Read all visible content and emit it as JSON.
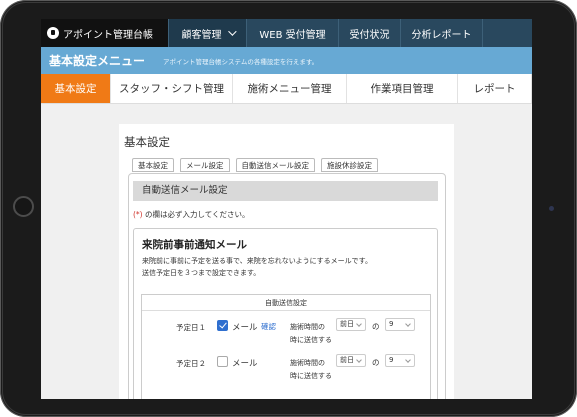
{
  "app": {
    "brand": "アポイント管理台帳"
  },
  "topnav": {
    "items": [
      {
        "label": "顧客管理"
      },
      {
        "label": "WEB 受付管理"
      },
      {
        "label": "受付状況"
      },
      {
        "label": "分析レポート"
      }
    ]
  },
  "banner": {
    "title": "基本設定メニュー",
    "subtitle": "アポイント管理台帳システムの各種設定を行えます。"
  },
  "tabs": [
    {
      "label": "基本設定",
      "active": true
    },
    {
      "label": "スタッフ・シフト管理"
    },
    {
      "label": "施術メニュー管理"
    },
    {
      "label": "作業項目管理"
    },
    {
      "label": "レポート"
    }
  ],
  "panel": {
    "title": "基本設定",
    "subtabs": [
      "基本設定",
      "メール設定",
      "自動送信メール設定",
      "施設休診設定"
    ],
    "section_title": "自動送信メール設定",
    "required_mark": "(*)",
    "required_text": " の欄は必ず入力してください。",
    "card": {
      "title": "来院前事前通知メール",
      "desc_line1": "来院前に事前に予定を送る事で、来院を忘れないようにするメールです。",
      "desc_line2": "送信予定日を３つまで設定できます。",
      "settings_header": "自動送信設定",
      "rows": [
        {
          "label": "予定日１",
          "checked": true,
          "mail_label": "メール",
          "confirm_link": "確認",
          "timing_prefix": "施術時間の",
          "day_option": "前日",
          "connector": "の",
          "hour_option": "9",
          "send_text": "時に送信する"
        },
        {
          "label": "予定日２",
          "checked": false,
          "mail_label": "メール",
          "timing_prefix": "施術時間の",
          "day_option": "前日",
          "connector": "の",
          "hour_option": "9",
          "send_text": "時に送信する"
        }
      ]
    }
  },
  "colors": {
    "topnav_bg": "#29485e",
    "banner_bg": "#67a9d4",
    "active_tab": "#f07a16",
    "link": "#2f6fcf",
    "required": "#d0342c"
  }
}
